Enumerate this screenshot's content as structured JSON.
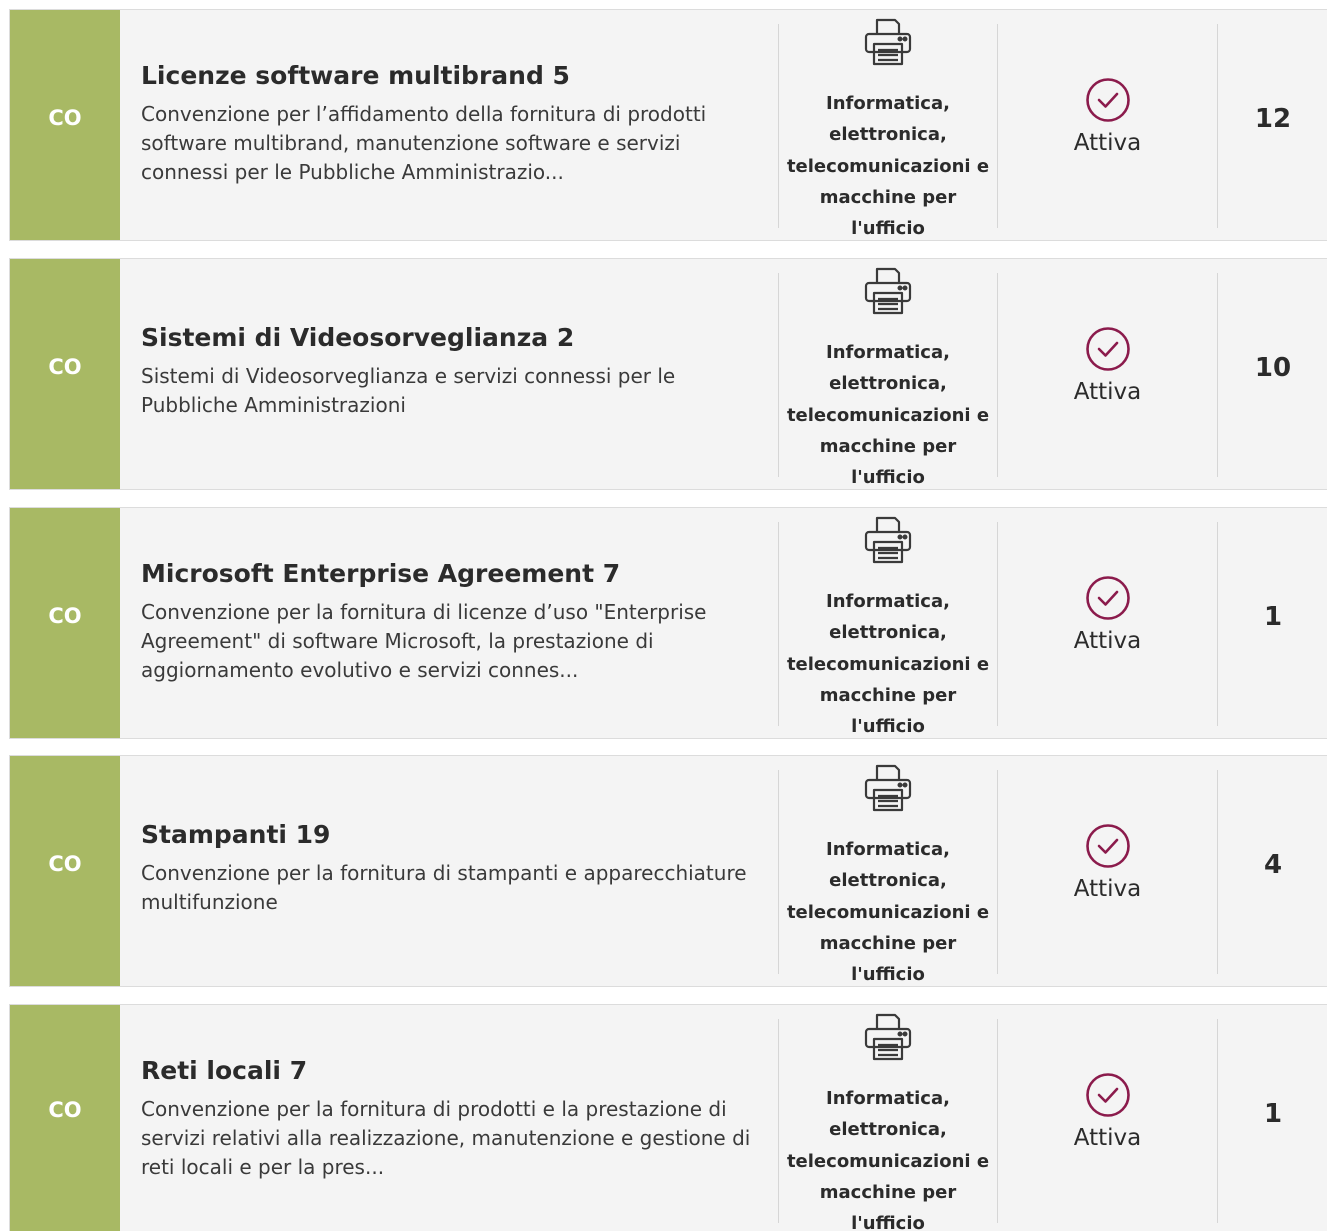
{
  "colors": {
    "badge": "#a8b964",
    "status_icon": "#8b1b4c",
    "card_background": "#f4f4f4"
  },
  "icons": {
    "category": "printer-icon",
    "status": "check-circle-icon"
  },
  "items": [
    {
      "badge": "CO",
      "title": "Licenze software multibrand 5",
      "description": "Convenzione per l’affidamento della fornitura di prodotti software multibrand, manutenzione software e servizi connessi per le Pubbliche Amministrazio...",
      "category": "Informatica, elettronica, telecomunicazioni e macchine per l'ufficio",
      "status": "Attiva",
      "count": "12"
    },
    {
      "badge": "CO",
      "title": "Sistemi di Videosorveglianza 2",
      "description": "Sistemi di Videosorveglianza e servizi connessi per le Pubbliche Amministrazioni",
      "category": "Informatica, elettronica, telecomunicazioni e macchine per l'ufficio",
      "status": "Attiva",
      "count": "10"
    },
    {
      "badge": "CO",
      "title": "Microsoft Enterprise Agreement 7",
      "description": "Convenzione per la fornitura di licenze d’uso \"Enterprise Agreement\" di software Microsoft, la prestazione di aggiornamento evolutivo e servizi connes...",
      "category": "Informatica, elettronica, telecomunicazioni e macchine per l'ufficio",
      "status": "Attiva",
      "count": "1"
    },
    {
      "badge": "CO",
      "title": "Stampanti 19",
      "description": "Convenzione per la fornitura di stampanti e apparecchiature multifunzione",
      "category": "Informatica, elettronica, telecomunicazioni e macchine per l'ufficio",
      "status": "Attiva",
      "count": "4"
    },
    {
      "badge": "CO",
      "title": "Reti locali 7",
      "description": "Convenzione per la fornitura di prodotti e la prestazione di servizi relativi alla realizzazione, manutenzione e gestione di reti locali e per la pres...",
      "category": "Informatica, elettronica, telecomunicazioni e macchine per l'ufficio",
      "status": "Attiva",
      "count": "1"
    }
  ]
}
